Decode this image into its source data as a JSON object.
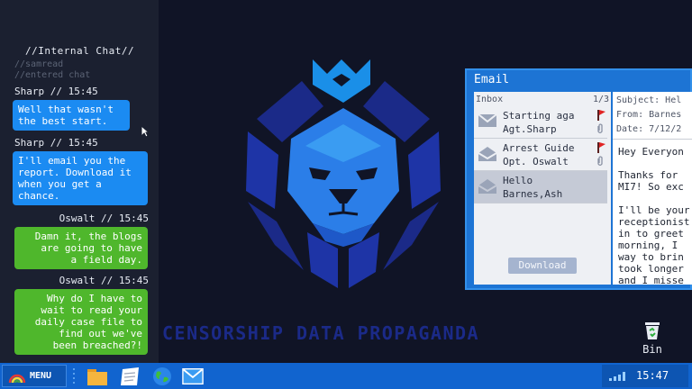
{
  "chat": {
    "title": "//Internal Chat//",
    "system_lines": [
      "//samread",
      "//entered chat"
    ],
    "messages": [
      {
        "sender": "Sharp // 15:45",
        "text_lines": [
          "Well that wasn't",
          "the best start."
        ]
      },
      {
        "sender": "Sharp // 15:45",
        "text_lines": [
          "I'll email you the",
          "report. Download it",
          "when you get a",
          "chance."
        ]
      },
      {
        "sender": "Oswalt // 15:45",
        "text_lines": [
          "Damn it, the blogs",
          "are going to have",
          "a field day."
        ]
      },
      {
        "sender": "Oswalt // 15:45",
        "text_lines": [
          "Why do I have to",
          "wait to read your",
          "daily case file to",
          "find out we've",
          "been breached?!"
        ]
      }
    ]
  },
  "desktop": {
    "watermark": "CENSORSHIP DATA PROPAGANDA",
    "bin_label": "Bin"
  },
  "email": {
    "title": "Email",
    "inbox_label": "Inbox",
    "page_count": "1/3",
    "items": [
      {
        "subject": "Starting aga",
        "from": "Agt.Sharp",
        "flag": true,
        "attachment": true
      },
      {
        "subject": "Arrest Guide",
        "from": "Opt. Oswalt",
        "flag": true,
        "attachment": true
      },
      {
        "subject": "Hello",
        "from": "Barnes,Ash",
        "flag": false,
        "attachment": false
      }
    ],
    "download_label": "Download",
    "reader": {
      "subject": "Subject: Hel",
      "from": "From: Barnes",
      "date": "Date: 7/12/2",
      "body_lines": [
        "Hey Everyon",
        "",
        "Thanks for",
        "MI7! So exc",
        "",
        "I'll be your",
        "receptionist",
        "in to greet",
        "morning, I",
        "way to brin",
        "took longer",
        "and I misse"
      ]
    }
  },
  "taskbar": {
    "menu_label": "MENU",
    "clock": "15:47"
  },
  "colors": {
    "chat_blue": "#1b8bf2",
    "chat_green": "#4fb72c",
    "taskbar": "#1164cf",
    "email_frame": "#1d74d4",
    "logo_dark": "#1b2a88",
    "logo_light": "#2b7ee8"
  },
  "icons": [
    "cursor-arrow-icon",
    "lion-logo-icon",
    "mail-envelope-icon",
    "flag-icon",
    "paperclip-icon",
    "recycle-bin-icon",
    "rainbow-menu-icon",
    "folder-icon",
    "notes-icon",
    "globe-icon",
    "mail-icon",
    "signal-icon"
  ]
}
